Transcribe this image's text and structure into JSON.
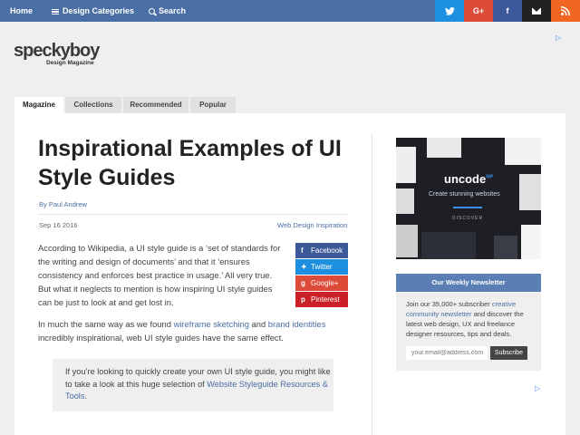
{
  "nav": {
    "home": "Home",
    "categories": "Design Categories",
    "search": "Search",
    "social": [
      {
        "name": "twitter",
        "glyph": "t",
        "color": "#1d8fe1"
      },
      {
        "name": "google-plus",
        "glyph": "G+",
        "color": "#dd4b39"
      },
      {
        "name": "facebook",
        "glyph": "f",
        "color": "#3b5998"
      },
      {
        "name": "email",
        "glyph": "",
        "color": "#222222"
      },
      {
        "name": "rss",
        "glyph": "",
        "color": "#f26522"
      }
    ]
  },
  "logo": {
    "name": "speckyboy",
    "tagline": "Design Magazine"
  },
  "tabs": [
    "Magazine",
    "Collections",
    "Recommended",
    "Popular"
  ],
  "article": {
    "title": "Inspirational Examples of UI Style Guides",
    "byline_prefix": "By ",
    "author": "Paul Andrew",
    "date": "Sep 16 2016",
    "category": "Web Design Inspiration",
    "p1": "According to Wikipedia, a UI style guide is a ‘set of standards for the writing and design of documents’ and that it ‘ensures consistency and enforces best practice in usage.’ All very true. But what it neglects to mention is how inspiring UI style guides can be just to look at and get lost in.",
    "p2_a": "In much the same way as we found ",
    "p2_link1": "wireframe sketching",
    "p2_b": " and ",
    "p2_link2": "brand identities",
    "p2_c": " incredibly inspirational, web UI style guides have the same effect.",
    "callout_a": "If you’re looking to quickly create your own UI style guide, you might like to take a look at this huge selection of ",
    "callout_link": "Website Styleguide Resources & Tools",
    "callout_b": "."
  },
  "share": {
    "facebook": "Facebook",
    "twitter": "Twitter",
    "googleplus": "Google+",
    "pinterest": "Pinterest"
  },
  "sidebar": {
    "ad": {
      "brand": "uncode",
      "brand_sup": "WP",
      "tagline": "Create stunning websites",
      "button": "DISCOVER"
    },
    "newsletter": {
      "heading": "Our Weekly Newsletter",
      "text_a": "Join our 35,000+ subscriber ",
      "text_link": "creative community newsletter",
      "text_b": " and discover the latest web design, UX and freelance designer resources, tips and deals.",
      "email_placeholder": "your.email@address.com",
      "subscribe": "Subscribe"
    }
  },
  "colors": {
    "accent": "#4a6fa5",
    "topbar": "#4a6fa5"
  }
}
